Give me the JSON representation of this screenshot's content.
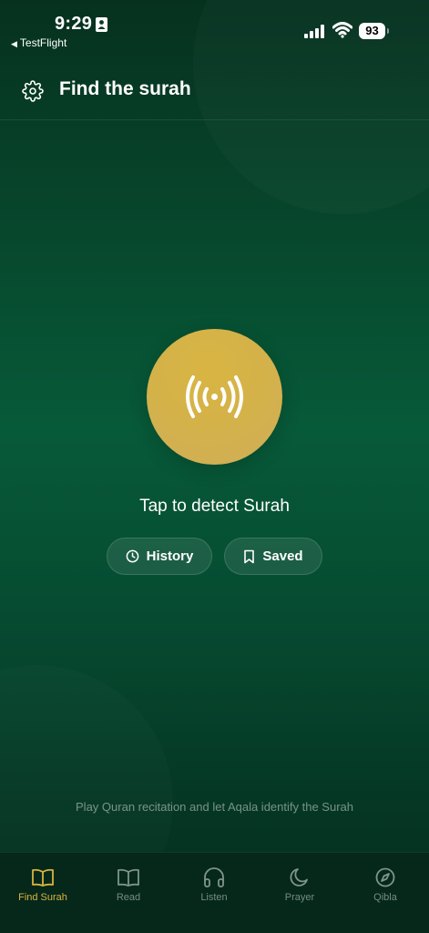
{
  "status_bar": {
    "time": "9:29",
    "back_app": "TestFlight",
    "battery": "93"
  },
  "header": {
    "title": "Find the surah"
  },
  "main": {
    "detect_label": "Tap to detect Surah",
    "history_label": "History",
    "saved_label": "Saved",
    "hint": "Play Quran recitation and let Aqala identify the Surah"
  },
  "tabs": [
    {
      "label": "Find Surah",
      "icon": "book-open-icon",
      "active": true
    },
    {
      "label": "Read",
      "icon": "book-icon",
      "active": false
    },
    {
      "label": "Listen",
      "icon": "headphones-icon",
      "active": false
    },
    {
      "label": "Prayer",
      "icon": "moon-icon",
      "active": false
    },
    {
      "label": "Qibla",
      "icon": "compass-icon",
      "active": false
    }
  ],
  "colors": {
    "background": "#075a39",
    "accent": "#d9b43f",
    "tab_inactive": "#7f9589"
  }
}
